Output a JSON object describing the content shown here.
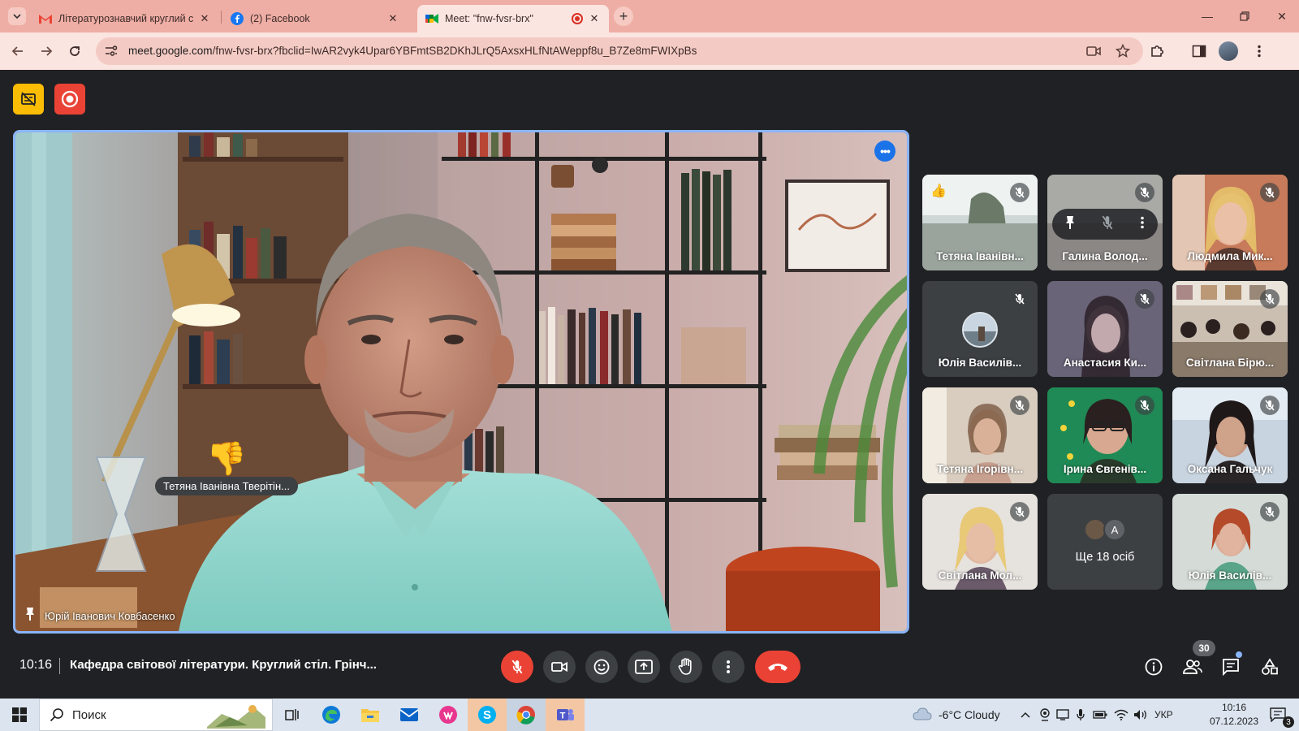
{
  "browser": {
    "tabs": [
      {
        "title": "Літературознавчий круглий ст",
        "favicon": "gmail-icon"
      },
      {
        "title": "(2) Facebook",
        "favicon": "facebook-icon"
      },
      {
        "title": "Meet: \"fnw-fvsr-brx\"",
        "favicon": "meet-icon",
        "recording": true,
        "active": true
      }
    ],
    "url_domain": "meet.google.com",
    "url_path": "/fnw-fvsr-brx?fbclid=IwAR2vyk4Upar6YBFmtSB2DKhJLrQ5AxsxHLfNtAWeppf8u_B7Ze8mFWIXpBs",
    "theme_color": "#efaea5"
  },
  "meet": {
    "main_speaker": {
      "name": "Юрій Іванович Ковбасенко"
    },
    "reaction": {
      "emoji": "👎",
      "from": "Тетяна Іванівна Тверітін..."
    },
    "participants": [
      {
        "name": "Тетяна Іванівн...",
        "muted": true,
        "reaction": "👍"
      },
      {
        "name": "Галина Волод...",
        "muted": true,
        "hover": true
      },
      {
        "name": "Людмила Мик...",
        "muted": true
      },
      {
        "name": "Юлія Василів...",
        "muted": true,
        "avatar": true
      },
      {
        "name": "Анастасия Ки...",
        "muted": true
      },
      {
        "name": "Світлана Бірю...",
        "muted": true
      },
      {
        "name": "Тетяна Ігорівн...",
        "muted": true
      },
      {
        "name": "Ірина Євгенів...",
        "muted": true
      },
      {
        "name": "Оксана Гальчук",
        "muted": true
      },
      {
        "name": "Світлана Мол...",
        "muted": true
      },
      {
        "name": "Ще 18 осіб",
        "more": true,
        "initial": "A"
      },
      {
        "name": "Юлія Василів...",
        "muted": true
      }
    ],
    "clock": "10:16",
    "meeting_title": "Кафедра світової літератури. Круглий стіл. Грінч...",
    "people_count": "30",
    "accent": "#8ab4f8",
    "end_call_color": "#ea4335"
  },
  "taskbar": {
    "search_label": "Поиск",
    "weather": "-6°C  Cloudy",
    "language": "УКР",
    "time": "10:16",
    "date": "07.12.2023",
    "notifications": "3"
  }
}
